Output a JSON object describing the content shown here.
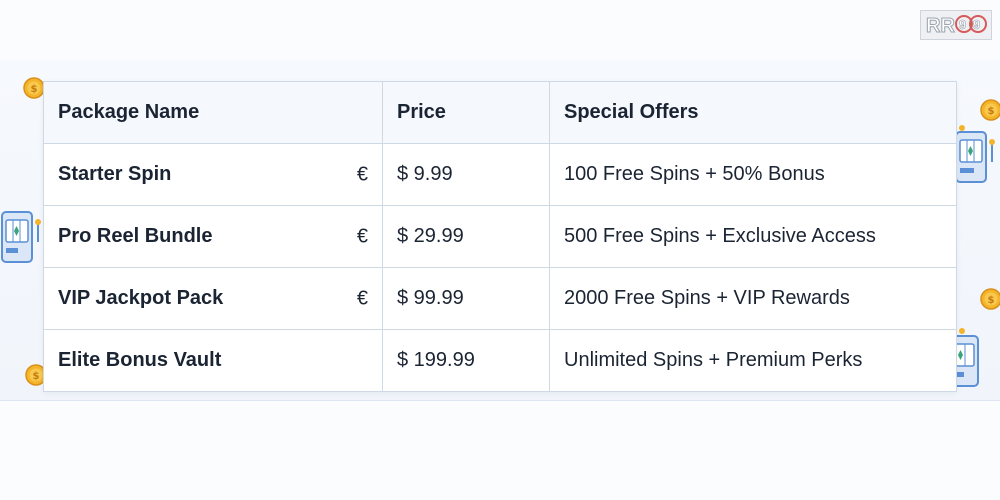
{
  "brand": {
    "logo_text": "RR99"
  },
  "table": {
    "headers": [
      "Package Name",
      "Price",
      "Special Offers"
    ],
    "rows": [
      {
        "name": "Starter Spin",
        "currency": "€",
        "price": "$ 9.99",
        "offer": "100 Free Spins + 50% Bonus"
      },
      {
        "name": "Pro Reel Bundle",
        "currency": "€",
        "price": "$ 29.99",
        "offer": "500 Free Spins + Exclusive Access"
      },
      {
        "name": "VIP Jackpot Pack",
        "currency": "€",
        "price": "$ 99.99",
        "offer": "2000 Free Spins + VIP Rewards"
      },
      {
        "name": "Elite Bonus Vault",
        "currency": "",
        "price": "$ 199.99",
        "offer": "Unlimited Spins + Premium Perks"
      }
    ]
  },
  "decorations": {
    "icons": [
      "dollar-coin-icon",
      "slot-machine-icon"
    ],
    "colors": {
      "coin": "#f5b52a",
      "slot": "#5b8fd6",
      "band": "#f1f5fb",
      "border": "#cfd9e4"
    }
  }
}
